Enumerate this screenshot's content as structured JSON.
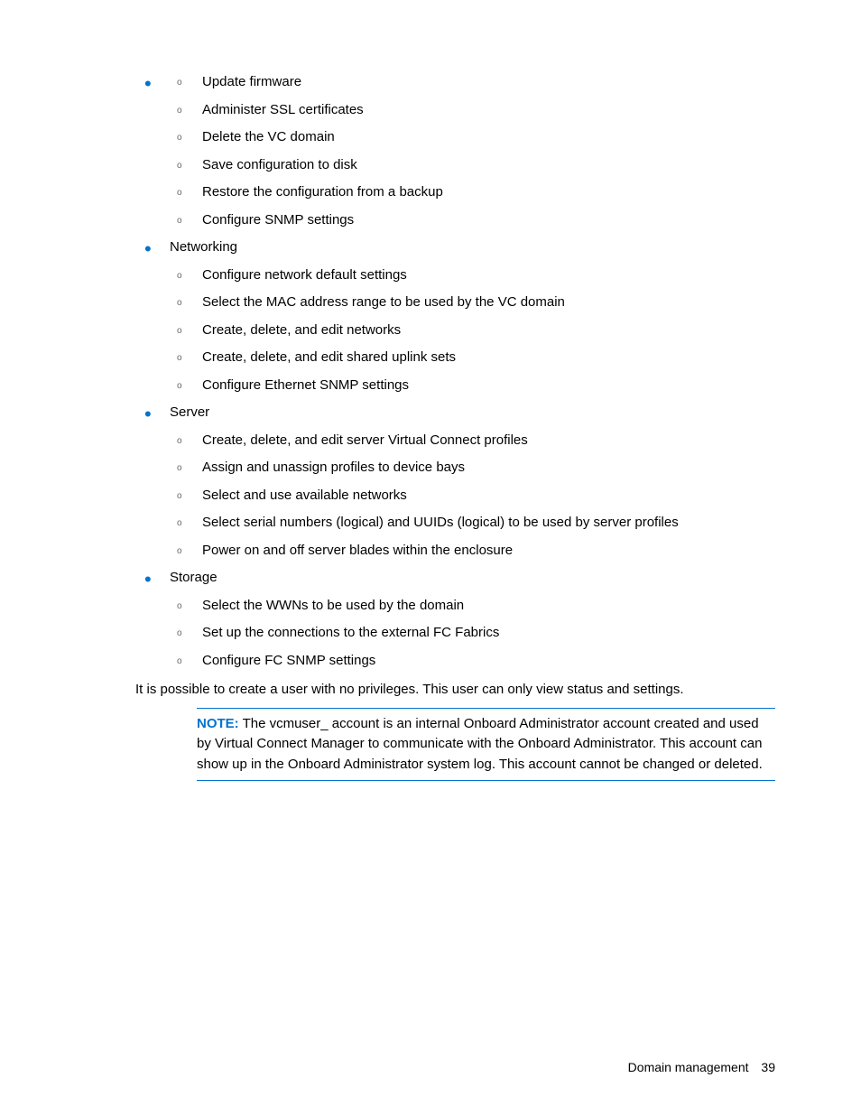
{
  "sections": {
    "orphan_items": [
      "Update firmware",
      "Administer SSL certificates",
      "Delete the VC domain",
      "Save configuration to disk",
      "Restore the configuration from a backup",
      "Configure SNMP settings"
    ],
    "groups": [
      {
        "title": "Networking",
        "items": [
          "Configure network default settings",
          "Select the MAC address range to be used by the VC domain",
          "Create, delete, and edit networks",
          "Create, delete, and edit shared uplink sets",
          "Configure Ethernet SNMP settings"
        ]
      },
      {
        "title": "Server",
        "items": [
          "Create, delete, and edit server Virtual Connect profiles",
          "Assign and unassign profiles to device bays",
          "Select and use available networks",
          "Select serial numbers (logical) and UUIDs (logical) to be used by server profiles",
          "Power on and off server blades within the enclosure"
        ]
      },
      {
        "title": "Storage",
        "items": [
          "Select the WWNs to be used by the domain",
          "Set up the connections to the external FC Fabrics",
          "Configure FC SNMP settings"
        ]
      }
    ]
  },
  "paragraph": "It is possible to create a user with no privileges. This user can only view status and settings.",
  "note": {
    "label": "NOTE:",
    "text": " The vcmuser_ account is an internal Onboard Administrator account created and used by Virtual Connect Manager to communicate with the Onboard Administrator. This account can show up in the Onboard Administrator system log. This account cannot be changed or deleted."
  },
  "footer": {
    "section": "Domain management",
    "page": "39"
  }
}
